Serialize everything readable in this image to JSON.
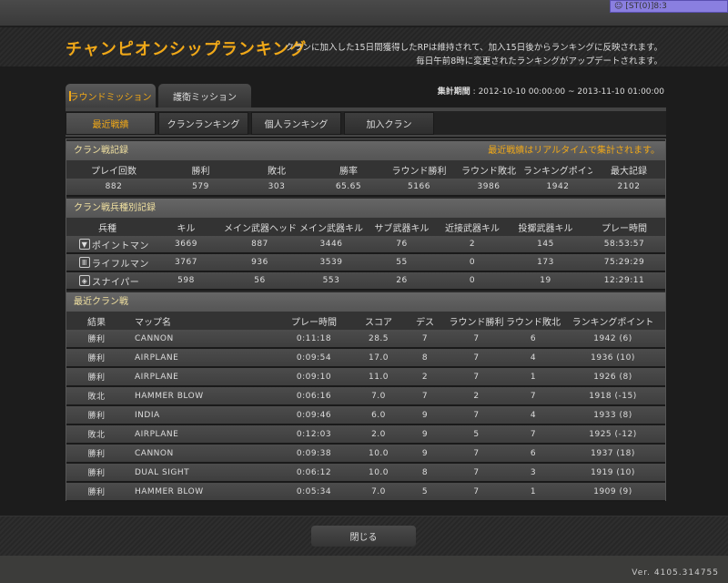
{
  "badge": {
    "text": "[ST(0)]8:3"
  },
  "header": {
    "title": "チャンピオンシップランキング",
    "notice_line1": "クランに加入した15日間獲得したRPは維持されて、加入15日後からランキングに反映されます。",
    "notice_line2": "毎日午前8時に変更されたランキングがアップデートされます。"
  },
  "period": {
    "label": "集計期間",
    "value": " : 2012-10-10 00:00:00 ~ 2013-11-10 01:00:00"
  },
  "tabs": [
    {
      "label": "ラウンドミッション"
    },
    {
      "label": "護衛ミッション"
    }
  ],
  "subtabs": [
    {
      "label": "最近戦績"
    },
    {
      "label": "クランランキング"
    },
    {
      "label": "個人ランキング"
    },
    {
      "label": "加入クラン"
    }
  ],
  "record": {
    "title": "クラン戦記録",
    "note": "最近戦績はリアルタイムで集計されます。",
    "headers": [
      "プレイ回数",
      "勝利",
      "敗北",
      "勝率",
      "ラウンド勝利",
      "ラウンド敗北",
      "ランキングポイント",
      "最大記録"
    ],
    "values": [
      "882",
      "579",
      "303",
      "65.65",
      "5166",
      "3986",
      "1942",
      "2102"
    ]
  },
  "classes": {
    "title": "クラン戦兵種別記録",
    "headers": [
      "兵種",
      "キル",
      "メイン武器ヘッドショット",
      "メイン武器キル",
      "サブ武器キル",
      "近接武器キル",
      "投擲武器キル",
      "プレー時間"
    ],
    "rows": [
      {
        "icon": "▼",
        "name": "ポイントマン",
        "cells": [
          "3669",
          "887",
          "3446",
          "76",
          "2",
          "145",
          "58:53:57"
        ]
      },
      {
        "icon": "Ⅲ",
        "name": "ライフルマン",
        "cells": [
          "3767",
          "936",
          "3539",
          "55",
          "0",
          "173",
          "75:29:29"
        ]
      },
      {
        "icon": "◈",
        "name": "スナイパー",
        "cells": [
          "598",
          "56",
          "553",
          "26",
          "0",
          "19",
          "12:29:11"
        ]
      }
    ]
  },
  "matches": {
    "title": "最近クラン戦",
    "headers": [
      "結果",
      "マップ名",
      "プレー時間",
      "スコア",
      "デス",
      "ラウンド勝利",
      "ラウンド敗北",
      "ランキングポイント"
    ],
    "rows": [
      [
        "勝利",
        "CANNON",
        "0:11:18",
        "28.5",
        "7",
        "7",
        "6",
        "1942 (6)"
      ],
      [
        "勝利",
        "AIRPLANE",
        "0:09:54",
        "17.0",
        "8",
        "7",
        "4",
        "1936 (10)"
      ],
      [
        "勝利",
        "AIRPLANE",
        "0:09:10",
        "11.0",
        "2",
        "7",
        "1",
        "1926 (8)"
      ],
      [
        "敗北",
        "HAMMER BLOW",
        "0:06:16",
        "7.0",
        "7",
        "2",
        "7",
        "1918 (-15)"
      ],
      [
        "勝利",
        "INDIA",
        "0:09:46",
        "6.0",
        "9",
        "7",
        "4",
        "1933 (8)"
      ],
      [
        "敗北",
        "AIRPLANE",
        "0:12:03",
        "2.0",
        "9",
        "5",
        "7",
        "1925 (-12)"
      ],
      [
        "勝利",
        "CANNON",
        "0:09:38",
        "10.0",
        "9",
        "7",
        "6",
        "1937 (18)"
      ],
      [
        "勝利",
        "DUAL SIGHT",
        "0:06:12",
        "10.0",
        "8",
        "7",
        "3",
        "1919 (10)"
      ],
      [
        "勝利",
        "HAMMER BLOW",
        "0:05:34",
        "7.0",
        "5",
        "7",
        "1",
        "1909 (9)"
      ]
    ]
  },
  "footer": {
    "close_label": "閉じる",
    "version": "Ver. 4105.314755"
  }
}
